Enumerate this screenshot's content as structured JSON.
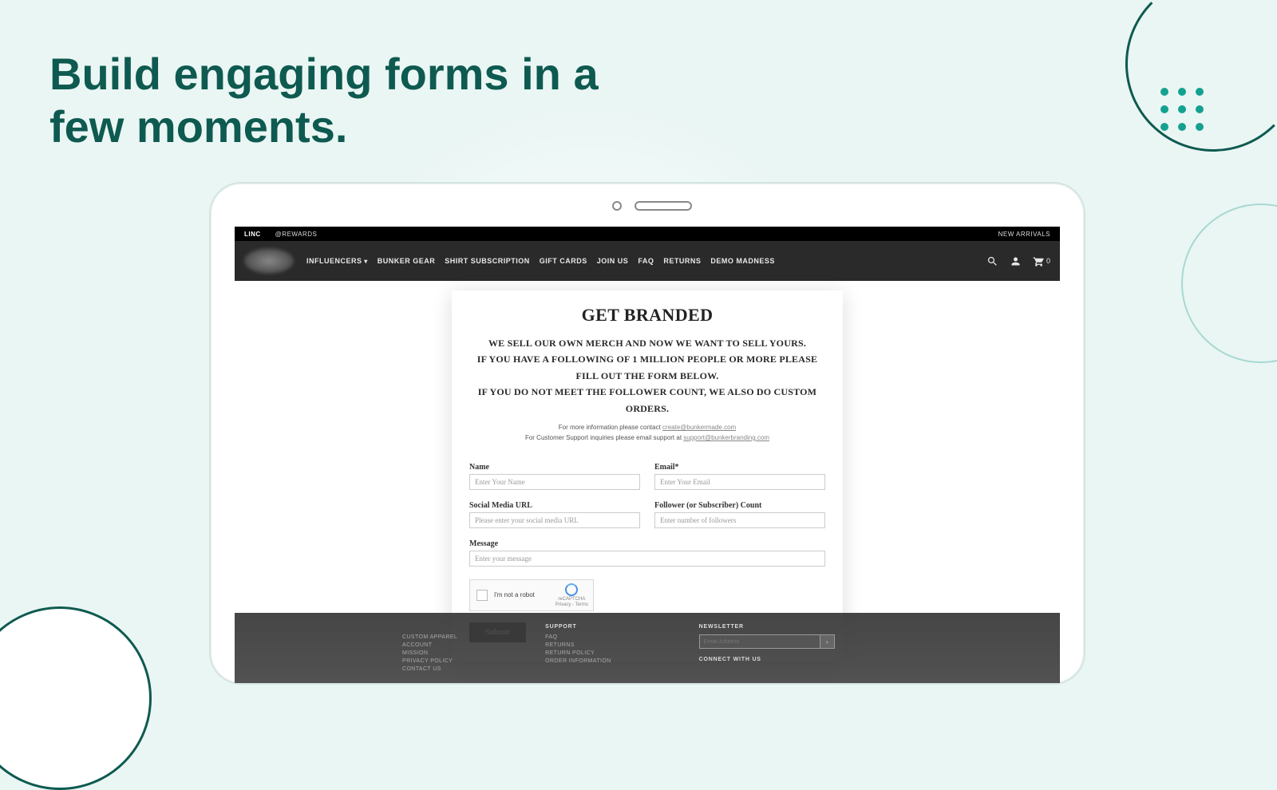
{
  "heading": "Build engaging forms in a few moments.",
  "topbar": {
    "linc": "LINC",
    "rewards": "@REWARDS",
    "right": "NEW ARRIVALS"
  },
  "nav": {
    "items": [
      "INFLUENCERS",
      "BUNKER GEAR",
      "SHIRT SUBSCRIPTION",
      "GIFT CARDS",
      "JOIN US",
      "FAQ",
      "RETURNS",
      "DEMO MADNESS"
    ],
    "cart_count": "0"
  },
  "form": {
    "title": "GET BRANDED",
    "sub1": "WE SELL OUR OWN MERCH AND NOW WE WANT TO SELL YOURS.",
    "sub2": "IF YOU HAVE A FOLLOWING OF 1 MILLION PEOPLE OR MORE PLEASE FILL OUT THE FORM BELOW.",
    "sub3": "IF YOU DO NOT MEET THE FOLLOWER COUNT, WE ALSO DO CUSTOM ORDERS.",
    "info1_pre": "For more information please contact ",
    "info1_link": "create@bunkermade.com",
    "info2_pre": "For Customer Support inquiries please email support at ",
    "info2_link": "support@bunkerbranding.com",
    "name_label": "Name",
    "name_ph": "Enter Your Name",
    "email_label": "Email*",
    "email_ph": "Enter Your Email",
    "social_label": "Social Media URL",
    "social_ph": "Please enter your social media URL",
    "follower_label": "Follower (or Subscriber) Count",
    "follower_ph": "Enter number of followers",
    "message_label": "Message",
    "message_ph": "Enter your message",
    "recaptcha_text": "I'm not a robot",
    "recaptcha_badge1": "reCAPTCHA",
    "recaptcha_badge2": "Privacy - Terms",
    "submit": "Submit"
  },
  "footer": {
    "col1": [
      "CUSTOM APPAREL",
      "ACCOUNT",
      "MISSION",
      "PRIVACY POLICY",
      "CONTACT US"
    ],
    "support_h": "SUPPORT",
    "col2": [
      "FAQ",
      "RETURNS",
      "RETURN POLICY",
      "ORDER INFORMATION"
    ],
    "news_h": "NEWSLETTER",
    "news_ph": "Email Address",
    "connect": "CONNECT WITH US"
  }
}
